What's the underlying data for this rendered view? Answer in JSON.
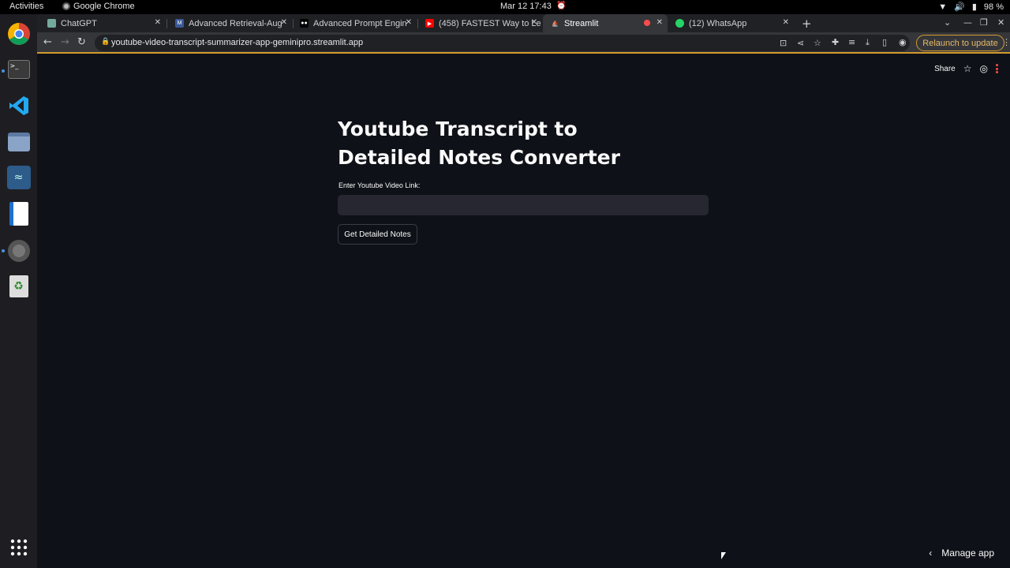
{
  "system": {
    "activities": "Activities",
    "app_name": "Google Chrome",
    "clock": "Mar 12  17:43",
    "battery": "98 %"
  },
  "dock": {
    "items": [
      "chrome-icon",
      "terminal-icon",
      "vscode-icon",
      "files-icon",
      "mysql-workbench-icon",
      "writer-icon",
      "disc-icon",
      "trash-icon"
    ],
    "grid_icon": "app-grid-icon"
  },
  "tabs": [
    {
      "label": "ChatGPT",
      "color": "#74aa9c"
    },
    {
      "label": "Advanced Retrieval-Aug",
      "color": "#3b5998"
    },
    {
      "label": "Advanced Prompt Engin",
      "color": "#000000"
    },
    {
      "label": "(458) FASTEST Way to Le",
      "color": "#ff0000"
    },
    {
      "label": "Streamlit",
      "color": "#ff4b4b"
    },
    {
      "label": "(12) WhatsApp",
      "color": "#25d366"
    }
  ],
  "toolbar": {
    "url": "youtube-video-transcript-summarizer-app-geminipro.streamlit.app",
    "relaunch": "Relaunch to update"
  },
  "app": {
    "header": {
      "share": "Share"
    },
    "title": "Youtube Transcript to Detailed Notes Converter",
    "input_label": "Enter Youtube Video Link:",
    "input_value": "",
    "button": "Get Detailed Notes",
    "manage": "Manage app"
  },
  "colors": {
    "accent": "#ff4b4b",
    "background": "#0e1117",
    "input_bg": "#262730",
    "relaunch": "#d39a2b"
  }
}
